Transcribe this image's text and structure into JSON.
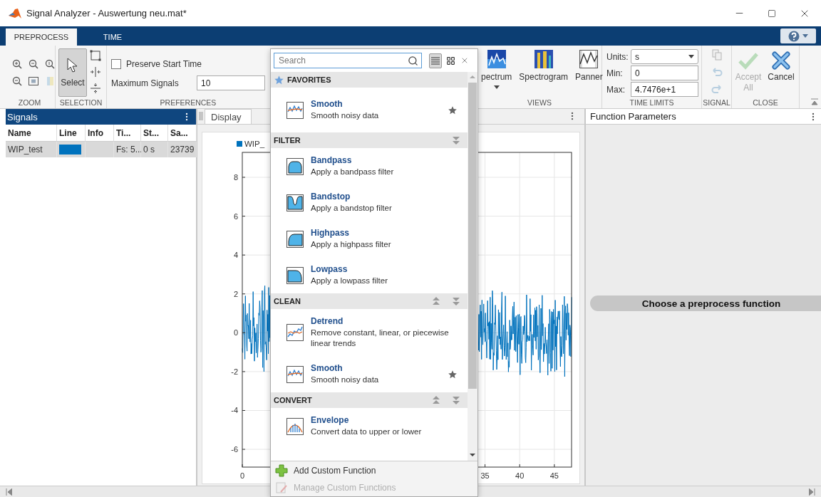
{
  "window": {
    "title": "Signal Analyzer - Auswertung neu.mat*"
  },
  "tabs": [
    {
      "label": "PREPROCESS",
      "selected": true
    },
    {
      "label": "TIME",
      "selected": false
    }
  ],
  "toolstrip": {
    "zoom": {
      "label": "ZOOM",
      "tools": [
        {
          "kind": "zoom-in",
          "disabled": false
        },
        {
          "kind": "zoom-x",
          "disabled": false
        },
        {
          "kind": "zoom-y",
          "disabled": false
        },
        {
          "kind": "zoom-out",
          "disabled": false
        },
        {
          "kind": "fit",
          "disabled": false
        },
        {
          "kind": "pan",
          "disabled": true
        }
      ]
    },
    "selection": {
      "label": "SELECTION",
      "select": {
        "label": "Select",
        "selected": true
      }
    },
    "preferences": {
      "label": "PREFERENCES",
      "preserve_start_time": {
        "label": "Preserve Start Time",
        "checked": false
      },
      "maximum_signals": {
        "label": "Maximum Signals",
        "value": "10"
      }
    },
    "views": {
      "label": "VIEWS",
      "buttons": [
        {
          "label": "pectrum",
          "kind": "spectrum",
          "dropdown": true
        },
        {
          "label": "Spectrogram",
          "kind": "spectrogram",
          "dropdown": false
        },
        {
          "label": "Panner",
          "kind": "panner",
          "dropdown": false
        }
      ]
    },
    "time_limits": {
      "label": "TIME LIMITS",
      "units": {
        "label": "Units:",
        "value": "s"
      },
      "min": {
        "label": "Min:",
        "value": "0"
      },
      "max": {
        "label": "Max:",
        "value": "4.7476e+1"
      }
    },
    "signal": {
      "label": "SIGNAL",
      "actions": [
        {
          "kind": "copy",
          "disabled": true
        },
        {
          "kind": "undo",
          "disabled": true
        },
        {
          "kind": "redo",
          "disabled": true
        }
      ]
    },
    "close": {
      "label": "CLOSE",
      "buttons": [
        {
          "label": "Accept All",
          "kind": "accept",
          "disabled": true
        },
        {
          "label": "Cancel",
          "kind": "cancel",
          "disabled": false
        }
      ]
    }
  },
  "signals_panel": {
    "title": "Signals",
    "columns": [
      "Name",
      "Line",
      "Info",
      "Ti...",
      "St...",
      "Sa..."
    ],
    "rows": [
      {
        "name": "WIP_test",
        "color": "#0072bd",
        "column_4": "Fs: 5...",
        "column_5": "0 s",
        "column_6": "23739",
        "selected": true
      }
    ]
  },
  "display_panel": {
    "tab": "Display",
    "legend": "WIP_",
    "y_ticks": [
      "8",
      "6",
      "4",
      "2",
      "0",
      "-2",
      "-4",
      "-6"
    ],
    "x_ticks": [
      "0",
      "35",
      "40",
      "45"
    ]
  },
  "function_parameters": {
    "title": "Function Parameters",
    "message": "Choose a preprocess function"
  },
  "function_gallery": {
    "search": {
      "placeholder": "Search"
    },
    "view_modes": [
      {
        "kind": "list",
        "selected": true
      },
      {
        "kind": "grid",
        "selected": false
      }
    ],
    "sections": [
      {
        "title": "FAVORITES",
        "kind": "favorites",
        "move_up": false,
        "move_down": false,
        "items": [
          {
            "name": "Smooth",
            "description": "Smooth noisy data",
            "kind": "smooth",
            "favorite": true
          }
        ]
      },
      {
        "title": "FILTER",
        "kind": "category",
        "move_up": false,
        "move_down": true,
        "items": [
          {
            "name": "Bandpass",
            "description": "Apply a bandpass filter",
            "kind": "bandpass",
            "favorite": false
          },
          {
            "name": "Bandstop",
            "description": "Apply a bandstop filter",
            "kind": "bandstop",
            "favorite": false
          },
          {
            "name": "Highpass",
            "description": "Apply a highpass filter",
            "kind": "highpass",
            "favorite": false
          },
          {
            "name": "Lowpass",
            "description": "Apply a lowpass filter",
            "kind": "lowpass",
            "favorite": false
          }
        ]
      },
      {
        "title": "CLEAN",
        "kind": "category",
        "move_up": true,
        "move_down": true,
        "items": [
          {
            "name": "Detrend",
            "description": "Remove constant, linear, or piecewise linear trends",
            "kind": "detrend",
            "favorite": false
          },
          {
            "name": "Smooth",
            "description": "Smooth noisy data",
            "kind": "smooth",
            "favorite": true
          }
        ]
      },
      {
        "title": "CONVERT",
        "kind": "category",
        "move_up": true,
        "move_down": true,
        "items": [
          {
            "name": "Envelope",
            "description": "Convert data to upper or lower",
            "kind": "envelope",
            "favorite": false
          }
        ]
      }
    ],
    "footer": [
      {
        "label": "Add Custom Function",
        "kind": "add",
        "disabled": false
      },
      {
        "label": "Manage Custom Functions",
        "kind": "manage",
        "disabled": true
      }
    ]
  }
}
